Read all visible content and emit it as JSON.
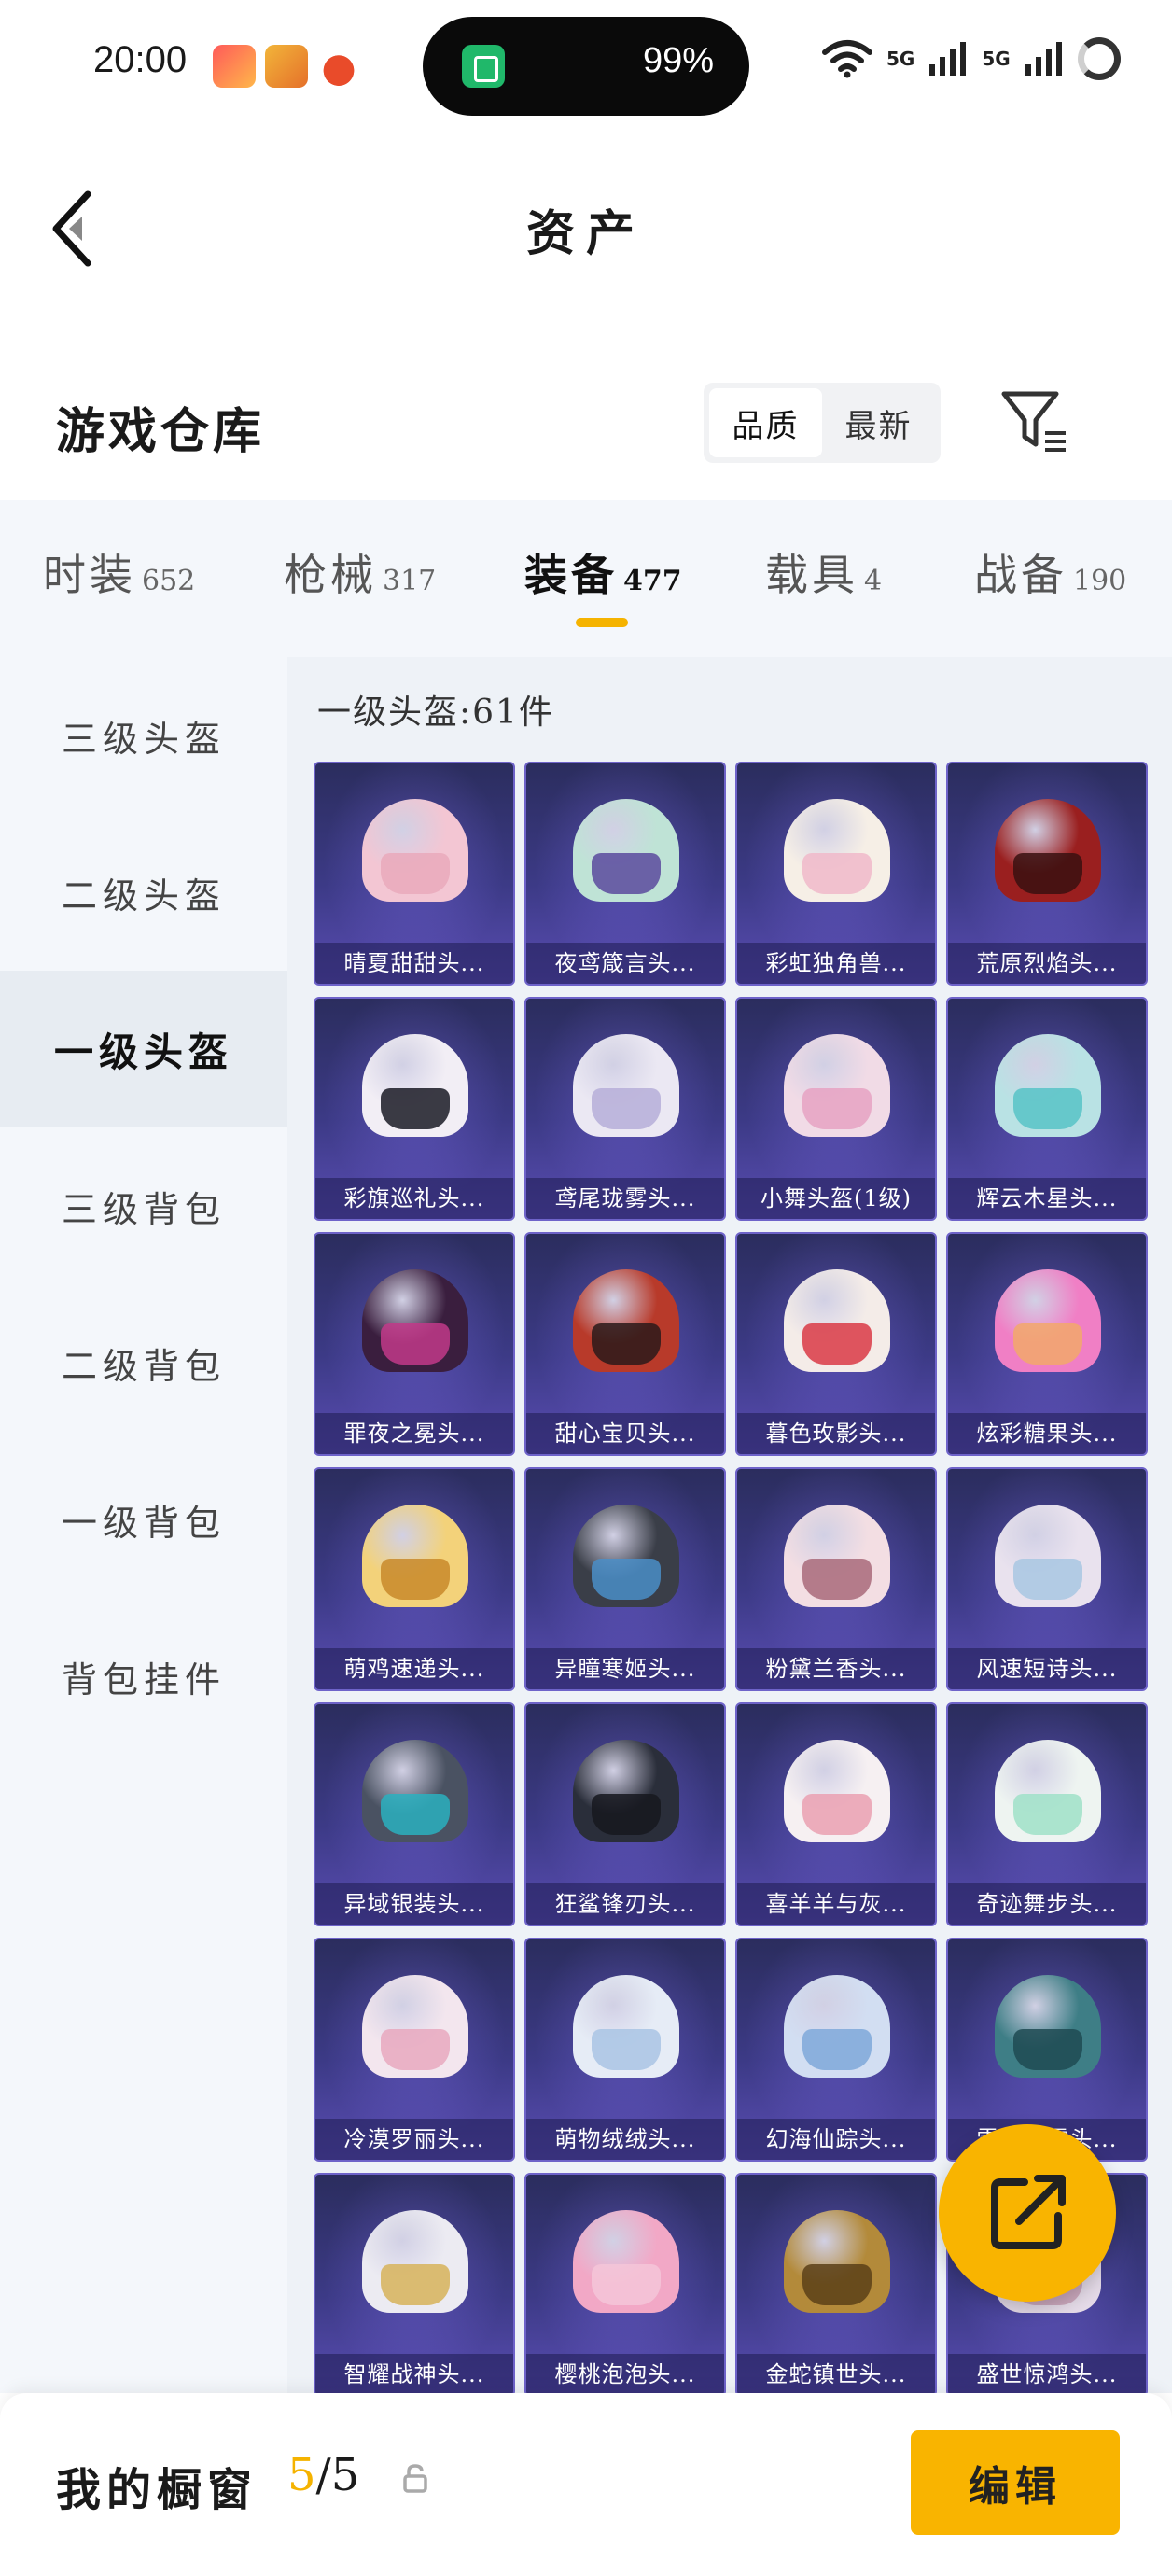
{
  "status_bar": {
    "time": "20:00",
    "battery": "99%",
    "net1": "5G",
    "net2": "5G"
  },
  "header": {
    "title": "资产"
  },
  "warehouse": {
    "title": "游戏仓库",
    "sort_options": [
      "品质",
      "最新"
    ],
    "sort_selected": "品质"
  },
  "tabs": [
    {
      "label": "时装",
      "count": "652"
    },
    {
      "label": "枪械",
      "count": "317"
    },
    {
      "label": "装备",
      "count": "477",
      "active": true
    },
    {
      "label": "载具",
      "count": "4"
    },
    {
      "label": "战备",
      "count": "190"
    }
  ],
  "sidebar": {
    "items": [
      "三级头盔",
      "二级头盔",
      "一级头盔",
      "三级背包",
      "二级背包",
      "一级背包",
      "背包挂件"
    ],
    "active_index": 2
  },
  "content": {
    "section_title": "一级头盔:61件",
    "items": [
      {
        "name": "晴夏甜甜头...",
        "shell": "#f3c6d3",
        "visor": "#e9a9bb"
      },
      {
        "name": "夜鸢箴言头...",
        "shell": "#bfe3d6",
        "visor": "#5b4a9e"
      },
      {
        "name": "彩虹独角兽...",
        "shell": "#f6efe6",
        "visor": "#f0b9c9"
      },
      {
        "name": "荒原烈焰头...",
        "shell": "#9a1f1f",
        "visor": "#3a1010"
      },
      {
        "name": "彩旗巡礼头...",
        "shell": "#f2eef5",
        "visor": "#1a1a24"
      },
      {
        "name": "鸢尾珑雾头...",
        "shell": "#ebe8f3",
        "visor": "#b6aed8"
      },
      {
        "name": "小舞头盔(1级)",
        "shell": "#f1dbe6",
        "visor": "#e6a2c2"
      },
      {
        "name": "辉云木星头...",
        "shell": "#b9e2e4",
        "visor": "#57c3c7"
      },
      {
        "name": "罪夜之冕头...",
        "shell": "#3a1e3e",
        "visor": "#c2398a"
      },
      {
        "name": "甜心宝贝头...",
        "shell": "#b83a2a",
        "visor": "#2a1a1a"
      },
      {
        "name": "暮色玫影头...",
        "shell": "#f4ece8",
        "visor": "#d93a45"
      },
      {
        "name": "炫彩糖果头...",
        "shell": "#f07fc5",
        "visor": "#f2a86a"
      },
      {
        "name": "萌鸡速递头...",
        "shell": "#f3d27a",
        "visor": "#c88a2a"
      },
      {
        "name": "异瞳寒姬头...",
        "shell": "#3a3e48",
        "visor": "#4a8ec8"
      },
      {
        "name": "粉黛兰香头...",
        "shell": "#f3dee3",
        "visor": "#a86a7a"
      },
      {
        "name": "风速短诗头...",
        "shell": "#e9e2ee",
        "visor": "#a8c7e2"
      },
      {
        "name": "异域银装头...",
        "shell": "#4a5262",
        "visor": "#2ab0c0"
      },
      {
        "name": "狂鲨锋刃头...",
        "shell": "#2a2e3a",
        "visor": "#16181e"
      },
      {
        "name": "喜羊羊与灰...",
        "shell": "#f6f0f2",
        "visor": "#eaa0b2"
      },
      {
        "name": "奇迹舞步头...",
        "shell": "#eef4f1",
        "visor": "#9fe0c8"
      },
      {
        "name": "冷漠罗丽头...",
        "shell": "#f3e6ee",
        "visor": "#e8a8be"
      },
      {
        "name": "萌物绒绒头...",
        "shell": "#e6ecf6",
        "visor": "#a9c4e4"
      },
      {
        "name": "幻海仙踪头...",
        "shell": "#d2def2",
        "visor": "#7fa8d9"
      },
      {
        "name": "雪月寒霜头...",
        "shell": "#3e7e86",
        "visor": "#1e4a52"
      },
      {
        "name": "智耀战神头...",
        "shell": "#ecebf2",
        "visor": "#d7b35a"
      },
      {
        "name": "樱桃泡泡头...",
        "shell": "#f2a8c6",
        "visor": "#f5c6d8"
      },
      {
        "name": "金蛇镇世头...",
        "shell": "#b38a3a",
        "visor": "#5a3f18"
      },
      {
        "name": "盛世惊鸿头...",
        "shell": "#e5dbe8",
        "visor": "#c8a0b6"
      }
    ]
  },
  "showcase": {
    "label": "我的橱窗",
    "current": "5",
    "total": "/5"
  },
  "edit_button": {
    "label": "编辑"
  },
  "colors": {
    "accent": "#f5b300",
    "card_bg": "#3c3a86"
  }
}
